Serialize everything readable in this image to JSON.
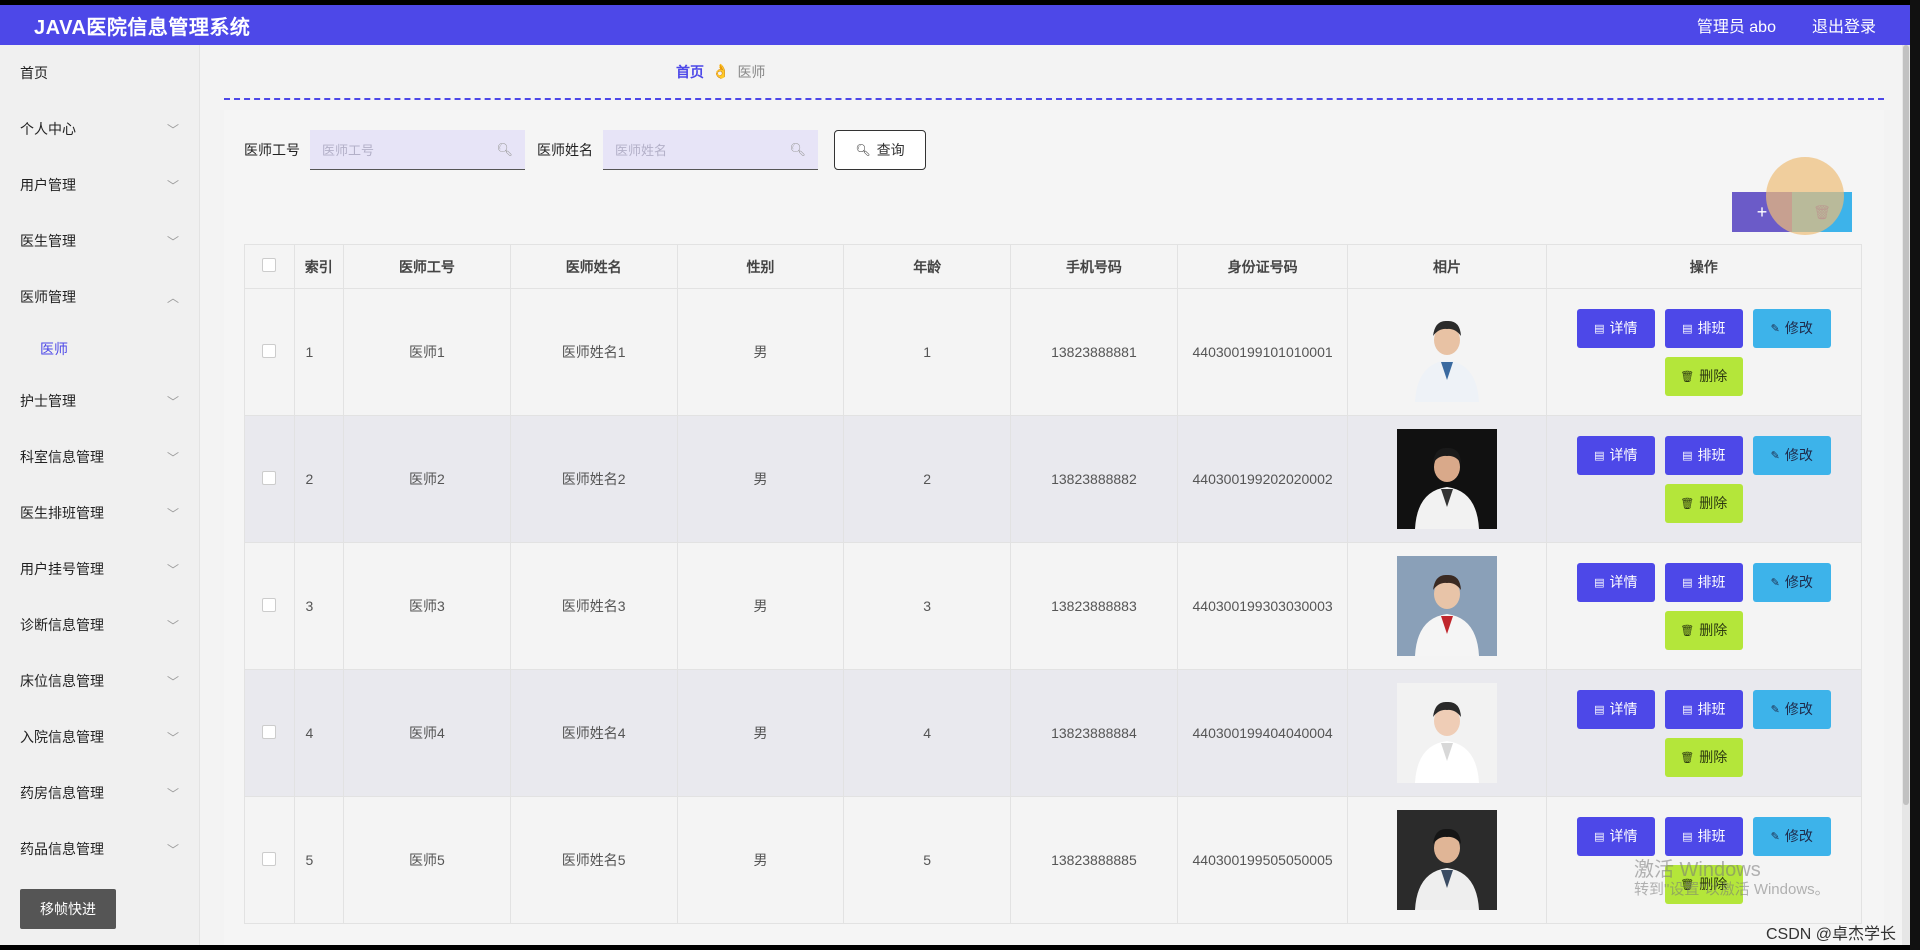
{
  "app": {
    "title": "JAVA医院信息管理系统",
    "user_label": "管理员 abo",
    "logout_label": "退出登录"
  },
  "colors": {
    "primary": "#4d48e8",
    "info": "#3db3ea",
    "danger_lime": "#b4e63a"
  },
  "sidebar": {
    "items": [
      {
        "label": "首页",
        "chevron": ""
      },
      {
        "label": "个人中心",
        "chevron": "﹀"
      },
      {
        "label": "用户管理",
        "chevron": "﹀"
      },
      {
        "label": "医生管理",
        "chevron": "﹀"
      },
      {
        "label": "医师管理",
        "chevron": "︿"
      },
      {
        "label": "护士管理",
        "chevron": "﹀"
      },
      {
        "label": "科室信息管理",
        "chevron": "﹀"
      },
      {
        "label": "医生排班管理",
        "chevron": "﹀"
      },
      {
        "label": "用户挂号管理",
        "chevron": "﹀"
      },
      {
        "label": "诊断信息管理",
        "chevron": "﹀"
      },
      {
        "label": "床位信息管理",
        "chevron": "﹀"
      },
      {
        "label": "入院信息管理",
        "chevron": "﹀"
      },
      {
        "label": "药房信息管理",
        "chevron": "﹀"
      },
      {
        "label": "药品信息管理",
        "chevron": "﹀"
      }
    ],
    "sub_item": "医师"
  },
  "breadcrumb": {
    "home": "首页",
    "current": "医师"
  },
  "search": {
    "id_label": "医师工号",
    "id_placeholder": "医师工号",
    "name_label": "医师姓名",
    "name_placeholder": "医师姓名",
    "query_label": "查询"
  },
  "toolbar": {
    "add_icon": "+",
    "delete_icon": "trash-icon"
  },
  "table": {
    "headers": [
      "",
      "索引",
      "医师工号",
      "医师姓名",
      "性别",
      "年龄",
      "手机号码",
      "身份证号码",
      "相片",
      "操作"
    ],
    "rows": [
      {
        "index": "1",
        "code": "医师1",
        "name": "医师姓名1",
        "gender": "男",
        "age": "1",
        "phone": "13823888881",
        "idcard": "440300199101010001"
      },
      {
        "index": "2",
        "code": "医师2",
        "name": "医师姓名2",
        "gender": "男",
        "age": "2",
        "phone": "13823888882",
        "idcard": "440300199202020002"
      },
      {
        "index": "3",
        "code": "医师3",
        "name": "医师姓名3",
        "gender": "男",
        "age": "3",
        "phone": "13823888883",
        "idcard": "440300199303030003"
      },
      {
        "index": "4",
        "code": "医师4",
        "name": "医师姓名4",
        "gender": "男",
        "age": "4",
        "phone": "13823888884",
        "idcard": "440300199404040004"
      },
      {
        "index": "5",
        "code": "医师5",
        "name": "医师姓名5",
        "gender": "男",
        "age": "5",
        "phone": "13823888885",
        "idcard": "440300199505050005"
      }
    ],
    "ops": {
      "detail": "详情",
      "schedule": "排班",
      "edit": "修改",
      "delete": "删除"
    }
  },
  "overlay": {
    "fab_label": "移帧快进",
    "watermark_line1": "激活 Windows",
    "watermark_line2": "转到\"设置\"以激活 Windows。",
    "csdn": "CSDN @卓杰学长"
  }
}
